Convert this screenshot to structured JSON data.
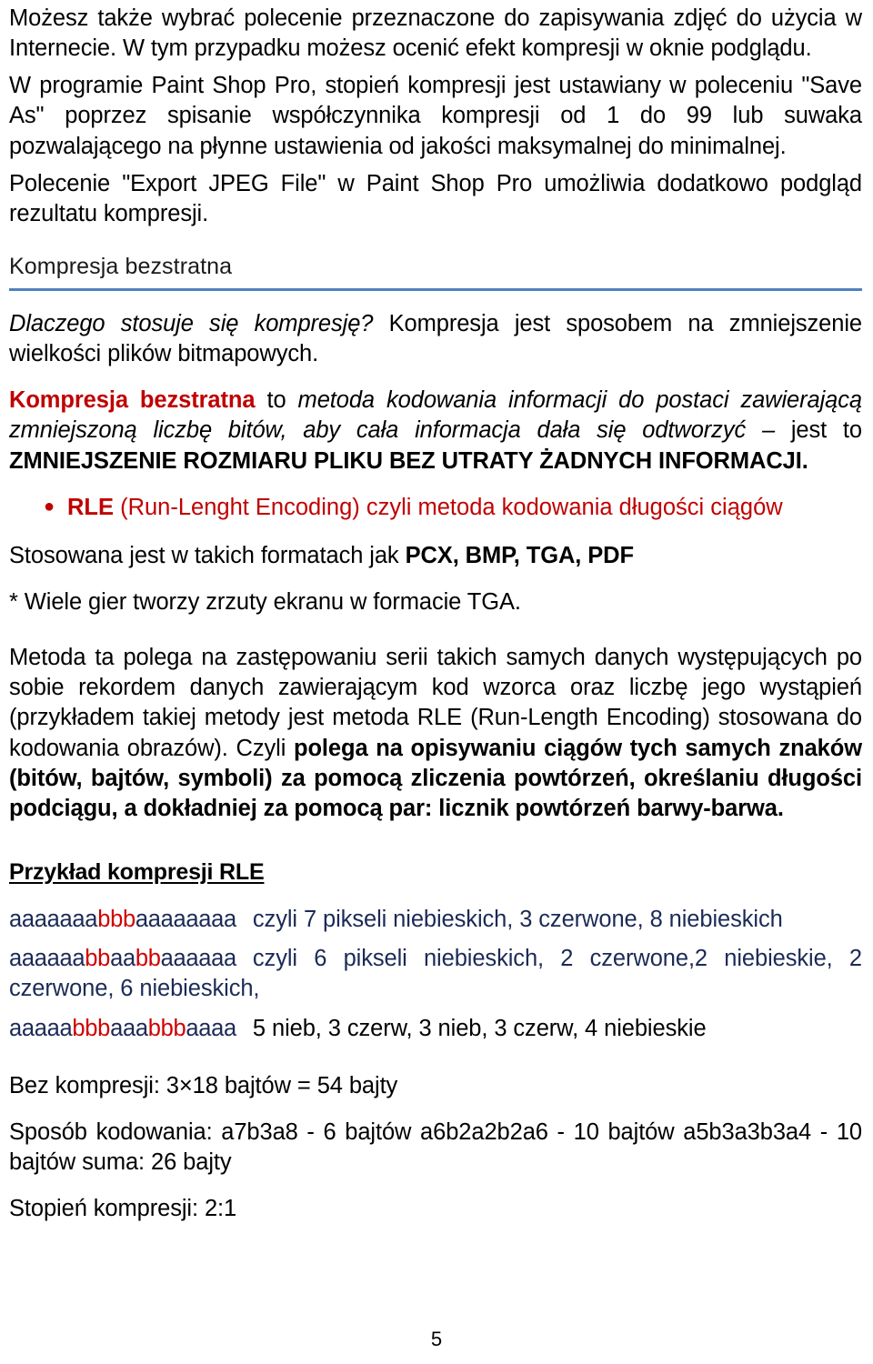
{
  "document": {
    "language": "pl",
    "page_number": "5",
    "colors": {
      "accent_rule": "#4F81BD",
      "highlight_red": "#C00000",
      "example_navy": "#1B2A56",
      "example_red": "#D00000",
      "body_text": "#000000"
    }
  },
  "intro": {
    "para1": "Możesz także wybrać polecenie przeznaczone do zapisywania zdjęć do użycia w Internecie. W tym przypadku możesz ocenić efekt kompresji w oknie podglądu.",
    "para2": "W programie Paint Shop Pro, stopień kompresji jest ustawiany w poleceniu \"Save As\" poprzez spisanie współczynnika kompresji od 1 do 99 lub suwaka pozwalającego na płynne ustawienia od jakości maksymalnej do minimalnej.",
    "para3": "Polecenie \"Export JPEG File\" w Paint Shop Pro umożliwia dodatkowo podgląd rezultatu kompresji."
  },
  "section": {
    "heading": "Kompresja bezstratna"
  },
  "why": {
    "question": "Dlaczego stosuje się kompresję?",
    "answer": " Kompresja jest sposobem na zmniejszenie wielkości plików bitmapowych."
  },
  "definition": {
    "term": "Kompresja bezstratna",
    "connector": " to  ",
    "italic_part": "metoda kodowania informacji do postaci zawierającą zmniejszoną liczbę bitów, aby cała informacja dała się odtworzyć – ",
    "tail": "jest to ",
    "bold_caps": "ZMNIEJSZENIE ROZMIARU PLIKU BEZ UTRATY ŻADNYCH INFORMACJI."
  },
  "bullet": {
    "marker": "bullet-dot-icon",
    "term": "RLE",
    "rest": " (Run-Lenght Encoding) czyli metoda kodowania długości ciągów"
  },
  "formats": {
    "lead": "Stosowana jest w takich formatach jak ",
    "list": "PCX, BMP, TGA, PDF"
  },
  "note": {
    "text": "* Wiele gier tworzy zrzuty ekranu w formacie TGA."
  },
  "method": {
    "plain": "Metoda ta polega na zastępowaniu serii takich samych danych występujących po sobie rekordem danych zawierającym kod wzorca oraz liczbę jego wystąpień (przykładem takiej metody jest metoda RLE (Run-Length Encoding) stosowana do kodowania obrazów).  Czyli ",
    "bold": "polega na opisywaniu ciągów tych samych znaków (bitów, bajtów, symboli) za pomocą zliczenia powtórzeń, określaniu długości podciągu, a dokładniej za pomocą par: licznik powtórzeń barwy-barwa."
  },
  "example": {
    "heading": "Przykład kompresji RLE",
    "rows": [
      {
        "sequence": [
          {
            "chars": "aaaaaaa",
            "color": "navy"
          },
          {
            "chars": "bbb",
            "color": "red"
          },
          {
            "chars": "aaaaaaaa",
            "color": "navy"
          }
        ],
        "description": "czyli 7 pikseli niebieskich, 3 czerwone, 8 niebieskich",
        "description_color": "navy"
      },
      {
        "sequence": [
          {
            "chars": "aaaaaa",
            "color": "navy"
          },
          {
            "chars": "bb",
            "color": "red"
          },
          {
            "chars": "aa",
            "color": "navy"
          },
          {
            "chars": "bb",
            "color": "red"
          },
          {
            "chars": "aaaaaa",
            "color": "navy"
          }
        ],
        "description": "czyli  6  pikseli  niebieskich,  2  czerwone,2  niebieskie,  2  czerwone,   6 niebieskich,",
        "description_color": "navy"
      },
      {
        "sequence": [
          {
            "chars": "aaaaa",
            "color": "navy"
          },
          {
            "chars": "bbb",
            "color": "red"
          },
          {
            "chars": "aaa",
            "color": "navy"
          },
          {
            "chars": "bbb",
            "color": "red"
          },
          {
            "chars": "aaaa",
            "color": "navy"
          }
        ],
        "description": "5 nieb, 3 czerw, 3 nieb, 3 czerw, 4 niebieskie",
        "description_color": "black"
      }
    ],
    "uncompressed": "Bez kompresji:   3×18 bajtów = 54 bajty",
    "encoding": "Sposób kodowania: a7b3a8 - 6  bajtów a6b2a2b2a6 - 10  bajtów a5b3a3b3a4 - 10 bajtów  suma: 26 bajty",
    "ratio": "Stopień kompresji: 2:1"
  }
}
